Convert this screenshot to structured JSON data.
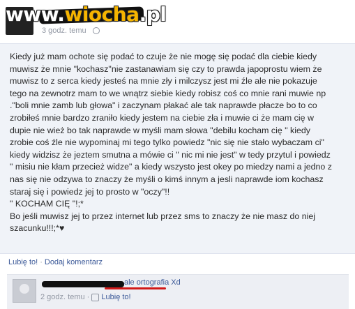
{
  "watermark": {
    "prefix": "www.",
    "accent": "wiocha",
    "suffix": ".pl"
  },
  "post": {
    "timestamp": "3 godz. temu",
    "text": "Kiedy już mam ochote się podać to czuje że nie mogę się podać dla ciebie kiedy\nmuwisz że mnie \"kochasz\"nie zastanawiam się czy to prawda japoprostu wiem że\nmuwisz to z serca kiedy jesteś na mnie zły i milczysz jest mi źle ale nie pokazuje\ntego na zewnotrz mam to we wnątrz siebie kiedy robisz coś co mnie rani muwie np\n.\"boli mnie zamb lub głowa\" i zaczynam płakać ale tak naprawde płacze bo to co\nzrobiłeś mnie bardzo zraniło kiedy jestem na ciebie zła i muwie ci że mam cię w\ndupie nie wież bo tak naprawde w myśli mam słowa \"debilu kocham cię \" kiedy\nzrobie coś źle nie wypominaj mi tego tylko powiedz \"nic się nie stało wybaczam ci\"\nkiedy widzisz że jeztem smutna a mówie ci \" nic mi nie jest\" w tedy przytul i powiedz\n\" misiu nie kłam przecież widze\" a kiedy wszysto jest okey po miedzy nami a jedno z\nnas się nie odzywa to znaczy że myśli o kimś innym a jesli naprawde iom kochasz\nstaraj się i powiedz jej to prosto w \"oczy\"!!\n\" KOCHAM CIĘ \"!;*\nBo jeśli muwisz jej to przez internet lub przez sms to znaczy że nie masz do niej\nszacunku!!!;*♥"
  },
  "actions": {
    "like": "Lubię to!",
    "separator": "·",
    "comment": "Dodaj komentarz"
  },
  "comment": {
    "text": "ale ortografia Xd",
    "timestamp": "2 godz. temu",
    "separator": "·",
    "like": "Lubię to!"
  },
  "colors": {
    "link": "#3b5998",
    "meta": "#9197a3",
    "post_bg": "#f0f3f8",
    "highlight_underline": "#d11818",
    "watermark_accent": "#f5b400"
  },
  "icons": [
    "gear-icon",
    "thumb-icon",
    "avatar-placeholder"
  ]
}
